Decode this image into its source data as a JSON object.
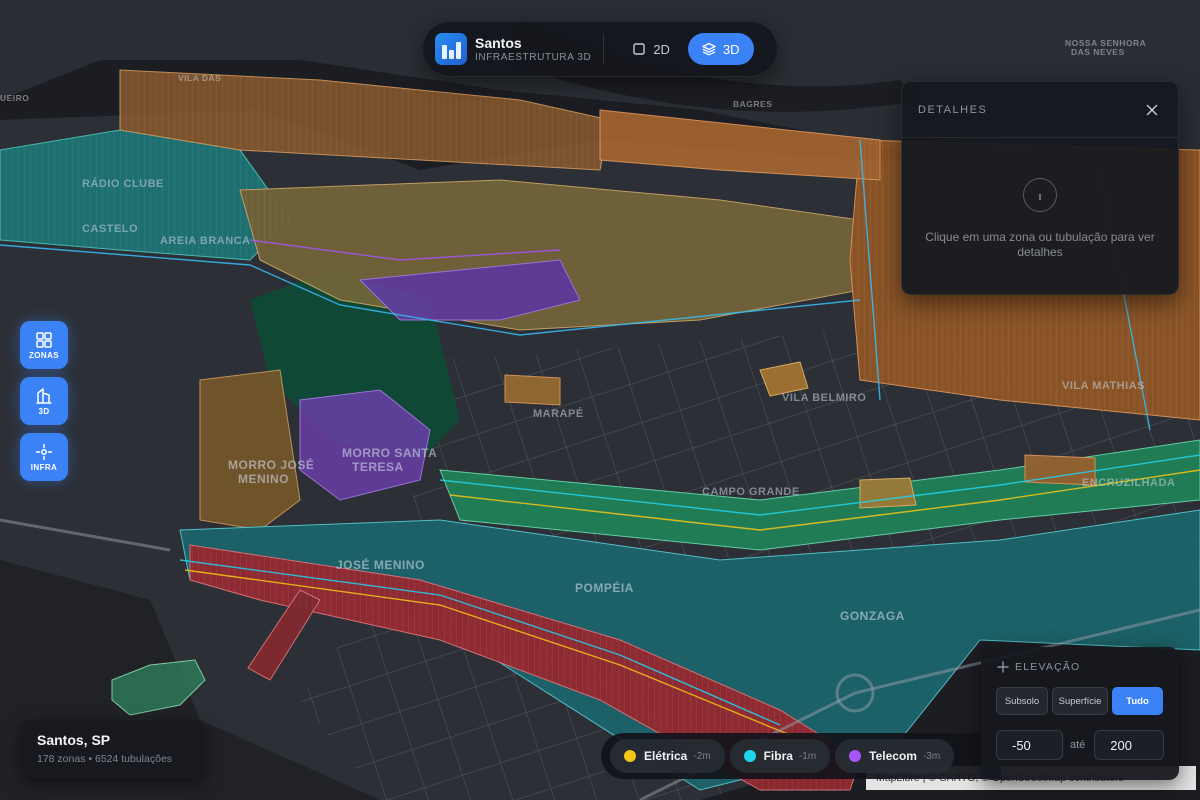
{
  "header": {
    "title": "Santos",
    "subtitle": "INFRAESTRUTURA 3D",
    "modes": [
      {
        "label": "2D",
        "icon": "square-icon",
        "active": false
      },
      {
        "label": "3D",
        "icon": "layers-icon",
        "active": true
      }
    ]
  },
  "side_buttons": [
    {
      "label": "ZONAS",
      "icon": "grid-icon"
    },
    {
      "label": "3D",
      "icon": "building-icon"
    },
    {
      "label": "INFRA",
      "icon": "crosshair-icon"
    }
  ],
  "details": {
    "title": "DETALHES",
    "empty_message": "Clique em uma zona ou tubulação para ver detalhes"
  },
  "location": {
    "title": "Santos, SP",
    "stats": "178 zonas • 6524 tubulações"
  },
  "legend": [
    {
      "label": "Elétrica",
      "depth": "-2m",
      "color": "#f5c518"
    },
    {
      "label": "Fibra",
      "depth": "-1m",
      "color": "#22d3ee"
    },
    {
      "label": "Telecom",
      "depth": "-3m",
      "color": "#a855f7"
    }
  ],
  "elevation": {
    "title": "ELEVAÇÃO",
    "options": [
      "Subsolo",
      "Superfície",
      "Tudo"
    ],
    "active_option": "Tudo",
    "min": "-50",
    "separator": "até",
    "max": "200"
  },
  "attribution": "MapLibre | © CARTO, © OpenStreetMap contributors",
  "map_labels": {
    "nossa_senhora": "NOSSA SENHORA",
    "das_neves": "DAS NEVES",
    "bagres": "BAGRES",
    "vila_das": "VILA DAS",
    "uceiro": "UEIRO",
    "radio_clube": "RÁDIO CLUBE",
    "castelo": "CASTELO",
    "areia_branca": "AREIA BRANCA",
    "morro_jose_menino_1": "MORRO JOSÉ",
    "morro_jose_menino_2": "MENINO",
    "morro_santa_1": "MORRO SANTA",
    "morro_santa_2": "TERESA",
    "jose_menino": "JOSÉ MENINO",
    "marape": "MARAPÉ",
    "vila_belmiro": "VILA BELMIRO",
    "campo_grande": "CAMPO GRANDE",
    "pompeia": "POMPÉIA",
    "gonzaga": "GONZAGA",
    "vila_mathias": "VILA MATHIAS",
    "encruzilhada": "ENCRUZILHADA"
  },
  "colors": {
    "accent": "#3b82f6",
    "zone_orange": "#c8782e",
    "zone_teal": "#1fa39a",
    "zone_green": "#22a05a",
    "zone_red": "#b3303a",
    "zone_purple": "#8a4fd0",
    "water": "#1a1c21",
    "land": "#2b2e34"
  }
}
